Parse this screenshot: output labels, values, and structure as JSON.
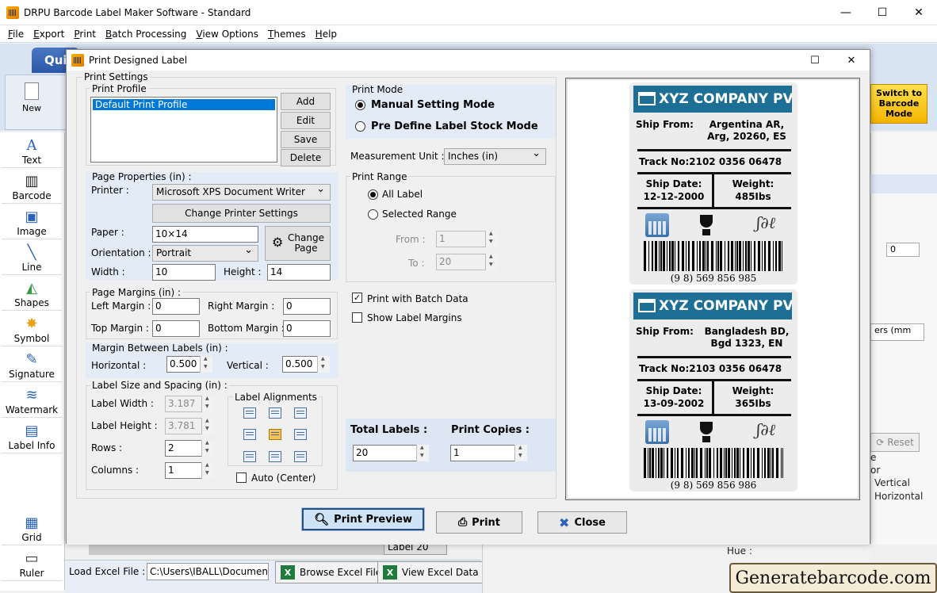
{
  "app": {
    "title": "DRPU Barcode Label Maker Software - Standard",
    "window_controls": [
      "—",
      "☐",
      "✕"
    ]
  },
  "menu": [
    "File",
    "Export",
    "Print",
    "Batch Processing",
    "View Options",
    "Themes",
    "Help"
  ],
  "quick_tab": "Qui",
  "new_label": "New",
  "switch_button": "Switch to Barcode Mode",
  "tools": [
    "Text",
    "Barcode",
    "Image",
    "Line",
    "Shapes",
    "Symbol",
    "Signature",
    "Watermark",
    "Label Info"
  ],
  "tools_bottom": [
    "Grid",
    "Ruler"
  ],
  "right_panel": {
    "field1": "0",
    "unit": "ers (mm",
    "reset": "Reset",
    "vertical": "Vertical",
    "horizontal": "Horizontal",
    "or": "or",
    "e": "e",
    "hue": "Hue :",
    "zero": "0"
  },
  "bottom": {
    "load_excel_label": "Load Excel File :",
    "load_excel_path": "C:\\Users\\IBALL\\Documen",
    "browse_excel": "Browse Excel File",
    "view_excel": "View Excel Data",
    "label_tab": "Label 20",
    "site": "Generatebarcode.com"
  },
  "dialog": {
    "title": "Print Designed Label",
    "print_settings": "Print Settings",
    "print_profile": "Print Profile",
    "profiles": [
      "Default Print Profile"
    ],
    "profile_buttons": [
      "Add",
      "Edit",
      "Save",
      "Delete"
    ],
    "page_properties": "Page Properties (in) :",
    "printer_label": "Printer :",
    "printer_value": "Microsoft XPS Document Writer",
    "change_printer": "Change Printer Settings",
    "paper_label": "Paper :",
    "paper_value": "10×14",
    "change_page": "Change Page",
    "orientation_label": "Orientation :",
    "orientation_value": "Portrait",
    "width_label": "Width :",
    "width_value": "10",
    "height_label": "Height :",
    "height_value": "14",
    "page_margins": "Page Margins (in) :",
    "left_margin_label": "Left Margin :",
    "left_margin": "0",
    "right_margin_label": "Right Margin :",
    "right_margin": "0",
    "top_margin_label": "Top Margin :",
    "top_margin": "0",
    "bottom_margin_label": "Bottom Margin :",
    "bottom_margin": "0",
    "margin_between": "Margin Between Labels (in) :",
    "horizontal_label": "Horizontal :",
    "horizontal_value": "0.500",
    "vertical_label": "Vertical :",
    "vertical_value": "0.500",
    "label_size": "Label Size and Spacing (in) :",
    "label_width_label": "Label Width :",
    "label_width": "3.187",
    "label_height_label": "Label Height :",
    "label_height": "3.781",
    "rows_label": "Rows :",
    "rows": "2",
    "columns_label": "Columns :",
    "columns": "1",
    "label_alignments": "Label Alignments",
    "auto_center": "Auto (Center)",
    "print_mode": "Print Mode",
    "manual_mode": "Manual Setting Mode",
    "predefine_mode": "Pre Define Label Stock Mode",
    "measurement_label": "Measurement Unit :",
    "measurement_value": "Inches (in)",
    "print_range": "Print Range",
    "all_label": "All Label",
    "selected_range": "Selected Range",
    "from_label": "From :",
    "from_value": "1",
    "to_label": "To :",
    "to_value": "20",
    "print_with_batch": "Print with Batch Data",
    "show_margins": "Show Label Margins",
    "total_labels_label": "Total Labels :",
    "total_labels": "20",
    "print_copies_label": "Print Copies :",
    "print_copies": "1",
    "btn_preview": "Print Preview",
    "btn_print": "Print",
    "btn_close": "Close"
  },
  "labels": [
    {
      "company": "XYZ COMPANY PVT",
      "ship_from_label": "Ship From:",
      "ship_from": "Argentina AR, Arg, 20260, ES",
      "track": "Track No:2102  0356  06478",
      "ship_date_label": "Ship Date:",
      "ship_date": "12-12-2000",
      "weight_label": "Weight:",
      "weight": "485Ibs",
      "barcode_number": "(9 8)  569 856 985"
    },
    {
      "company": "XYZ COMPANY PVT",
      "ship_from_label": "Ship From:",
      "ship_from": "Bangladesh BD, Bgd 1323, EN",
      "track": "Track No:2103  0356  06478",
      "ship_date_label": "Ship Date:",
      "ship_date": "13-09-2002",
      "weight_label": "Weight:",
      "weight": "365Ibs",
      "barcode_number": "(9 8)  569 856 986"
    }
  ]
}
